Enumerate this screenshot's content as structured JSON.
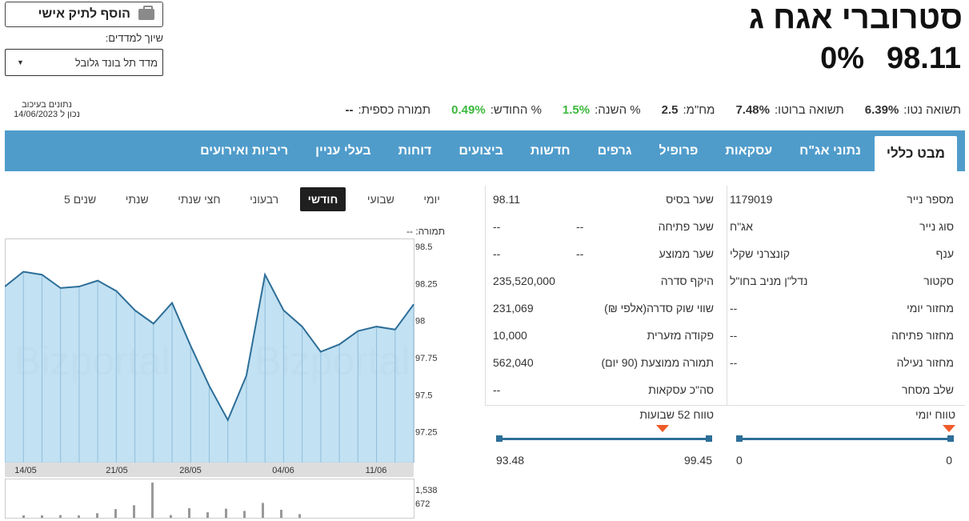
{
  "header": {
    "title": "סטרוברי אגח ג",
    "price": "98.11",
    "change": "0%",
    "add_portfolio": "הוסף לתיק אישי",
    "index_label": "שיוך למדדים:",
    "index_selected": "מדד תל בונד גלובל",
    "asof_line1": "נתונים בעיכוב",
    "asof_line2": "נכון ל 14/06/2023"
  },
  "stats": [
    {
      "label": "תמורה כספית:",
      "value": "--"
    },
    {
      "label": "% החודש:",
      "value": "0.49%",
      "color": "#3cb83c"
    },
    {
      "label": "% השנה:",
      "value": "1.5%",
      "color": "#3cb83c"
    },
    {
      "label": "מח\"מ:",
      "value": "2.5"
    },
    {
      "label": "תשואה ברוטו:",
      "value": "7.48%"
    },
    {
      "label": "תשואה נטו:",
      "value": "6.39%"
    }
  ],
  "tabs": [
    "מבט כללי",
    "נתוני אג\"ח",
    "עסקאות",
    "פרופיל",
    "גרפים",
    "חדשות",
    "ביצועים",
    "דוחות",
    "בעלי עניין",
    "ריביות ואירועים"
  ],
  "info_col1": [
    {
      "label": "מספר נייר",
      "value": "1179019"
    },
    {
      "label": "סוג נייר",
      "value": "אג\"ח"
    },
    {
      "label": "ענף",
      "value": "קונצרני שקלי"
    },
    {
      "label": "סקטור",
      "value": "נדל\"ן מניב בחו\"ל"
    },
    {
      "label": "מחזור יומי",
      "value": "--"
    },
    {
      "label": "מחזור פתיחה",
      "value": "--"
    },
    {
      "label": "מחזור נעילה",
      "value": "--"
    },
    {
      "label": "שלב מסחר",
      "value": ""
    }
  ],
  "info_col2": [
    {
      "label": "שער בסיס",
      "value": "98.11",
      "mid": ""
    },
    {
      "label": "שער פתיחה",
      "value": "--",
      "mid": "--"
    },
    {
      "label": "שער ממוצע",
      "value": "--",
      "mid": "--"
    },
    {
      "label": "היקף סדרה",
      "value": "235,520,000",
      "mid": ""
    },
    {
      "label": "שווי שוק סדרה(אלפי ₪)",
      "value": "231,069",
      "mid": ""
    },
    {
      "label": "פקודה מזערית",
      "value": "10,000",
      "mid": ""
    },
    {
      "label": "תמורה ממוצעת (90 יום)",
      "value": "562,040",
      "mid": ""
    },
    {
      "label": "סה\"כ עסקאות",
      "value": "--",
      "mid": ""
    }
  ],
  "daily_range": {
    "title": "טווח יומי",
    "low": "0",
    "high": "0"
  },
  "week52_range": {
    "title": "טווח 52 שבועות",
    "low": "93.48",
    "high": "99.45"
  },
  "periods": [
    "יומי",
    "שבועי",
    "חודשי",
    "רבעוני",
    "חצי שנתי",
    "שנתי",
    "5 שנים"
  ],
  "active_period": "חודשי",
  "volume_label": "תמורה: --",
  "colors": {
    "tab_bar": "#4f9ccb",
    "accent_green": "#3cb83c",
    "range_bar": "#2d6e98",
    "range_marker": "#f05a28",
    "area_fill": "#b7dcf0",
    "line": "#2d6e98"
  },
  "chart_data": {
    "type": "area",
    "x": [
      "12/05",
      "14/05",
      "15/05",
      "16/05",
      "17/05",
      "18/05",
      "21/05",
      "22/05",
      "23/05",
      "24/05",
      "25/05",
      "28/05",
      "29/05",
      "30/05",
      "31/05",
      "01/06",
      "04/06",
      "05/06",
      "06/06",
      "07/06",
      "08/06",
      "11/06",
      "12/06",
      "13/06",
      "14/06"
    ],
    "y": [
      98.23,
      98.33,
      98.31,
      98.22,
      98.23,
      98.27,
      98.2,
      98.07,
      97.98,
      98.12,
      97.83,
      97.56,
      97.33,
      97.63,
      98.31,
      98.07,
      97.96,
      97.79,
      97.84,
      97.93,
      97.96,
      97.94,
      98.11
    ],
    "xticks": [
      "14/05",
      "21/05",
      "28/05",
      "04/06",
      "11/06"
    ],
    "yticks": [
      98.5,
      98.25,
      98,
      97.75,
      97.5,
      97.25
    ],
    "ylim": [
      97.0,
      98.5
    ],
    "volume_ticks": [
      "1,538",
      "672"
    ],
    "volume": [
      60,
      100,
      120,
      30,
      200,
      380,
      550,
      1538,
      120,
      420,
      240,
      400,
      300,
      650,
      350,
      160
    ],
    "watermark": "Bizportal"
  }
}
